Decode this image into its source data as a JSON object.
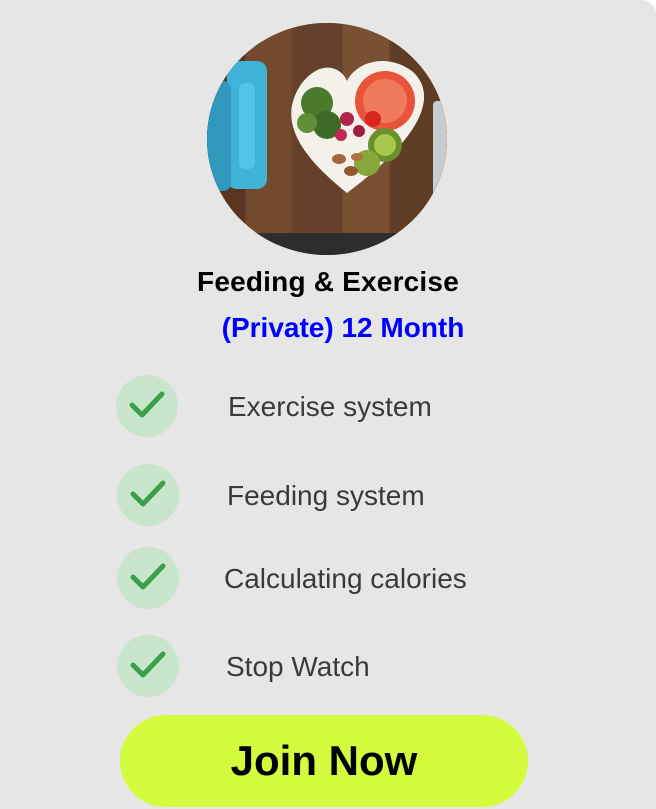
{
  "colors": {
    "card_background": "#e6e6e6",
    "accent": "#0000ff",
    "check_circle": "#c9e5cc",
    "check_mark": "#3aa04a",
    "button_background": "#d4fb3d"
  },
  "hero_image": {
    "icon": "food-and-dumbbell-photo"
  },
  "plan": {
    "title": "Feeding & Exercise",
    "subtitle": "(Private) 12 Month"
  },
  "features": [
    {
      "label": "Exercise system",
      "icon": "check-icon"
    },
    {
      "label": "Feeding system",
      "icon": "check-icon"
    },
    {
      "label": "Calculating calories",
      "icon": "check-icon"
    },
    {
      "label": "Stop Watch",
      "icon": "check-icon"
    }
  ],
  "cta": {
    "label": "Join Now"
  }
}
